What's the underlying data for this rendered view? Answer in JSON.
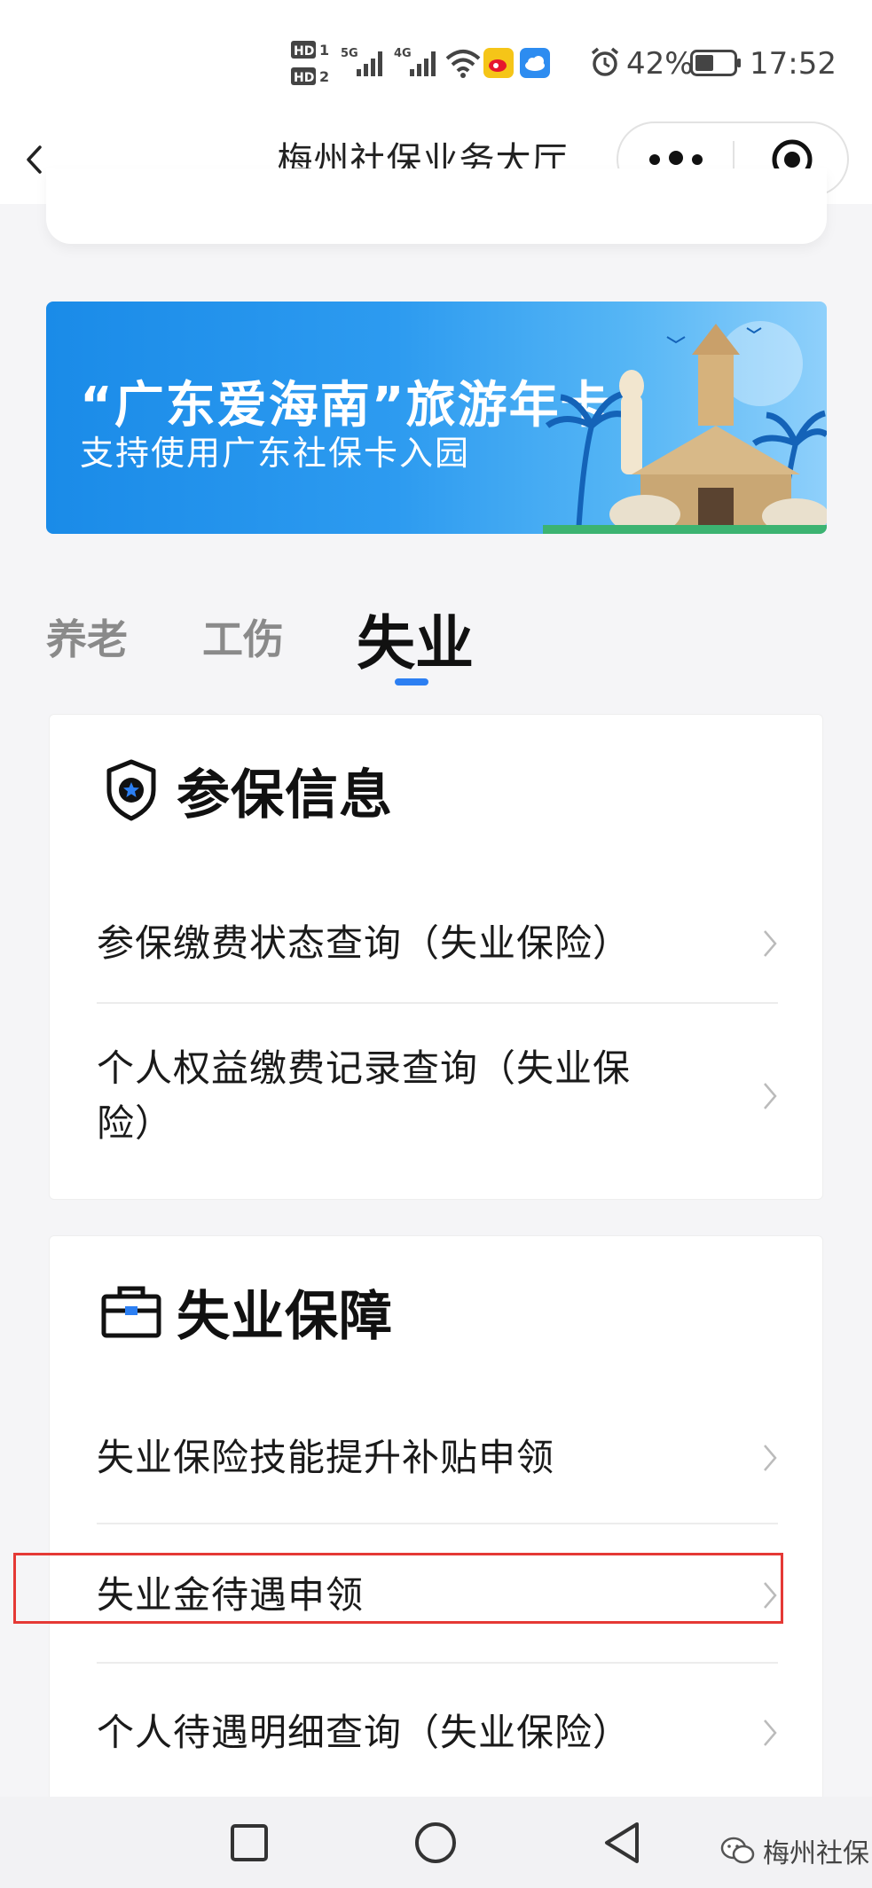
{
  "status_bar": {
    "network_left": "HD",
    "network_1": "1",
    "network_2": "2",
    "sig5g": "5G",
    "sig4g": "4G",
    "battery": "42%",
    "time": "17:52"
  },
  "header": {
    "back_icon": "chevron-left-icon",
    "title": "梅州社保业务大厅",
    "more_icon": "more-dots-icon",
    "close_icon": "target-close-icon"
  },
  "banner": {
    "title": "“广东爱海南”旅游年卡",
    "subtitle": "支持使用广东社保卡入园"
  },
  "tabs": [
    {
      "label": "养老",
      "active": false
    },
    {
      "label": "工伤",
      "active": false
    },
    {
      "label": "失业",
      "active": true
    }
  ],
  "sections": [
    {
      "title": "参保信息",
      "icon": "shield-star-icon",
      "items": [
        {
          "label": "参保缴费状态查询（失业保险）"
        },
        {
          "label": "个人权益缴费记录查询（失业保险）"
        }
      ]
    },
    {
      "title": "失业保障",
      "icon": "briefcase-icon",
      "items": [
        {
          "label": "失业保险技能提升补贴申领"
        },
        {
          "label": "失业金待遇申领"
        },
        {
          "label": "个人待遇明细查询（失业保险）"
        }
      ]
    }
  ],
  "nav": {
    "recents_icon": "square-icon",
    "home_icon": "circle-icon",
    "back_icon": "triangle-back-icon"
  },
  "watermark": "梅州社保",
  "colors": {
    "accent": "#2c7ff2",
    "highlight": "#e53935",
    "banner_start": "#1a8be8",
    "banner_end": "#8fd0fb"
  }
}
